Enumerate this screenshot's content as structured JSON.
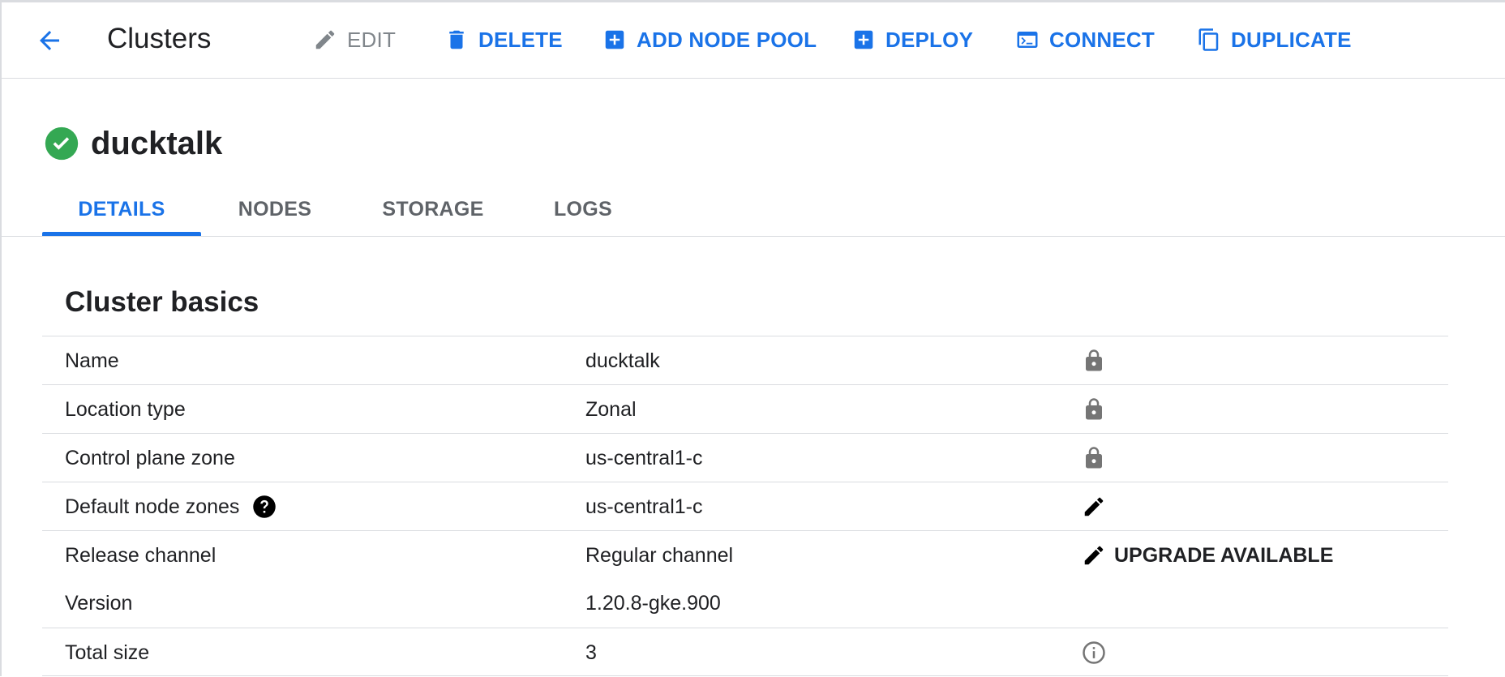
{
  "toolbar": {
    "title": "Clusters",
    "actions": {
      "edit": "EDIT",
      "delete": "DELETE",
      "add_node_pool": "ADD NODE POOL",
      "deploy": "DEPLOY",
      "connect": "CONNECT",
      "duplicate": "DUPLICATE"
    }
  },
  "cluster": {
    "name": "ducktalk",
    "status_icon": "check-circle-icon",
    "status_color": "#34a853"
  },
  "tabs": [
    {
      "label": "DETAILS",
      "active": true
    },
    {
      "label": "NODES",
      "active": false
    },
    {
      "label": "STORAGE",
      "active": false
    },
    {
      "label": "LOGS",
      "active": false
    }
  ],
  "section": {
    "title": "Cluster basics",
    "rows": [
      {
        "label": "Name",
        "value": "ducktalk",
        "icon": "lock-icon"
      },
      {
        "label": "Location type",
        "value": "Zonal",
        "icon": "lock-icon"
      },
      {
        "label": "Control plane zone",
        "value": "us-central1-c",
        "icon": "lock-icon"
      },
      {
        "label": "Default node zones",
        "value": "us-central1-c",
        "icon": "edit-icon",
        "help": true
      },
      {
        "label": "Release channel",
        "value": "Regular channel",
        "icon": "edit-icon",
        "action_label": "UPGRADE AVAILABLE"
      },
      {
        "label": "Version",
        "value": "1.20.8-gke.900"
      },
      {
        "label": "Total size",
        "value": "3",
        "icon": "info-icon"
      }
    ]
  },
  "colors": {
    "accent": "#1a73e8",
    "disabled": "#80868b",
    "text": "#202124",
    "divider": "#dadce0",
    "icon_gray": "#757575"
  }
}
